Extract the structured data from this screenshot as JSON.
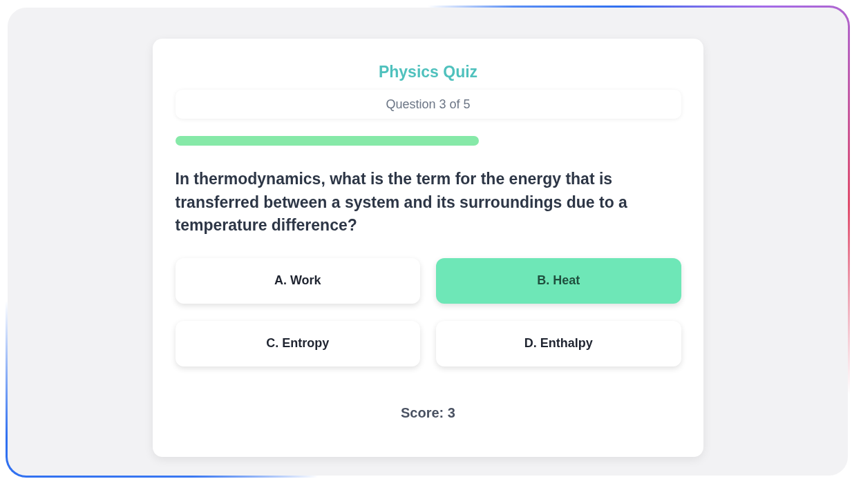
{
  "quiz": {
    "title": "Physics Quiz",
    "counter": "Question 3 of 5",
    "progress": {
      "level": 0.6
    },
    "question": "In thermodynamics, what is the term for the energy that is transferred between a system and its surroundings due to a temperature difference?",
    "options": [
      {
        "label": "A. Work",
        "selected": false
      },
      {
        "label": "B. Heat",
        "selected": true
      },
      {
        "label": "C. Entropy",
        "selected": false
      },
      {
        "label": "D. Enthalpy",
        "selected": false
      }
    ],
    "score": "Score: 3"
  }
}
